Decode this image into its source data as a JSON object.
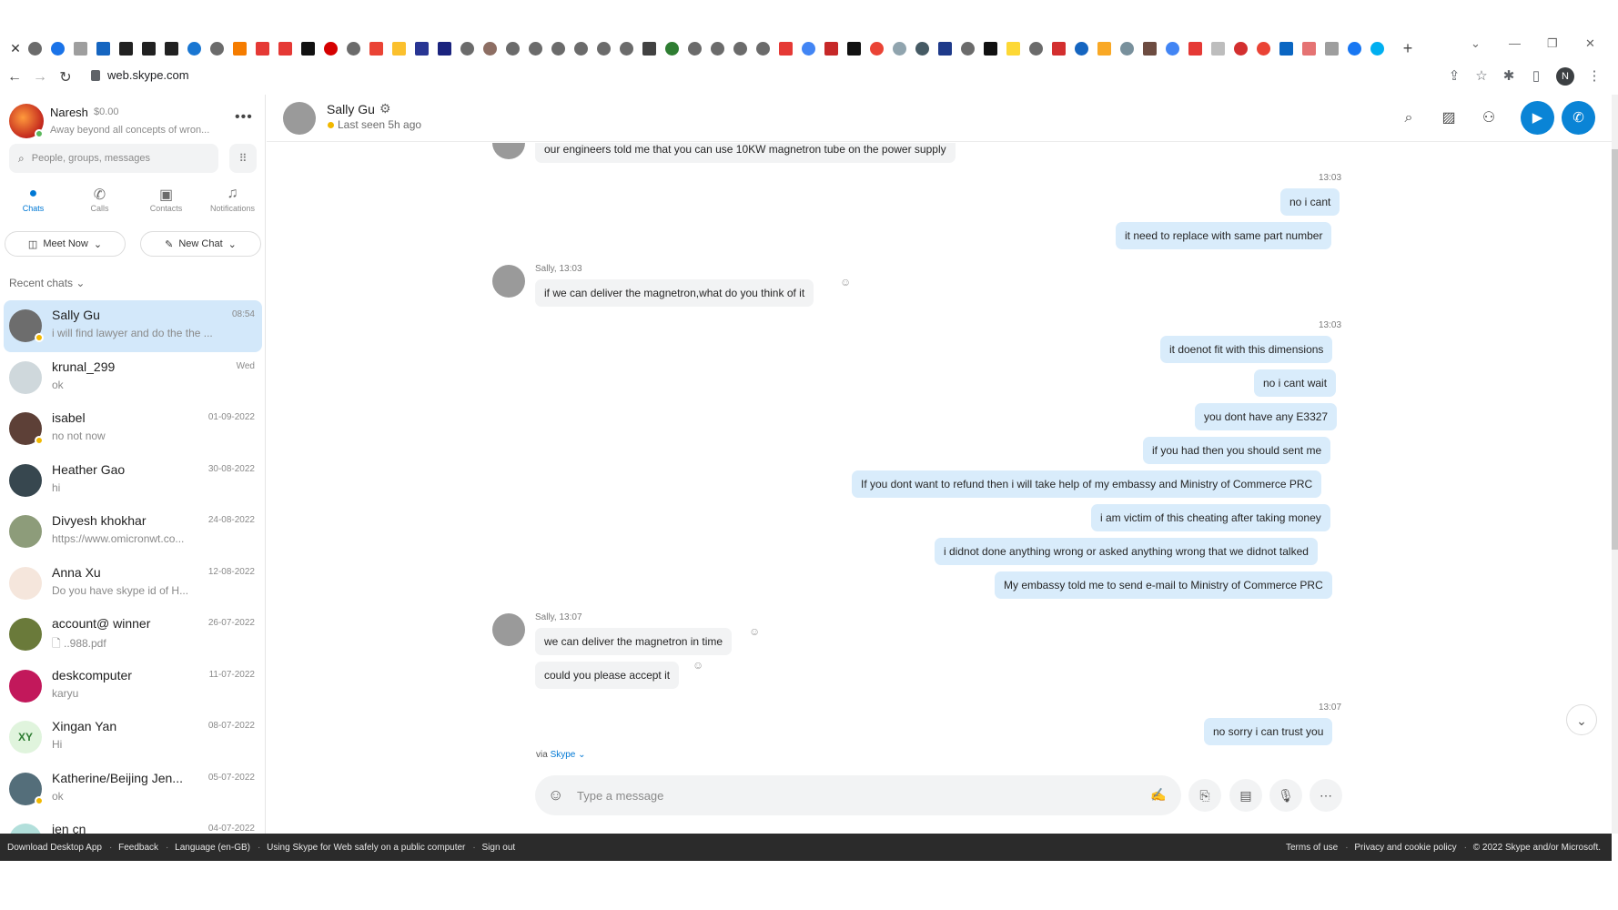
{
  "browser": {
    "url": "web.skype.com",
    "profile_initial": "N",
    "new_tab_label": "+"
  },
  "me": {
    "name": "Naresh",
    "credit": "$0.00",
    "mood": "Away beyond all concepts of wron..."
  },
  "search": {
    "placeholder": "People, groups, messages"
  },
  "nav": {
    "chats": "Chats",
    "calls": "Calls",
    "contacts": "Contacts",
    "notifications": "Notifications"
  },
  "actions": {
    "meet_now": "Meet Now",
    "new_chat": "New Chat"
  },
  "recent_label": "Recent chats",
  "chats": [
    {
      "name": "Sally Gu",
      "preview": "i will find lawyer and do the the ...",
      "date": "08:54",
      "selected": true
    },
    {
      "name": "krunal_299",
      "preview": "ok",
      "date": "Wed"
    },
    {
      "name": "isabel",
      "preview": "no not now",
      "date": "01-09-2022"
    },
    {
      "name": "Heather Gao",
      "preview": "hi",
      "date": "30-08-2022"
    },
    {
      "name": "Divyesh khokhar",
      "preview": "https://www.omicronwt.co...",
      "date": "24-08-2022"
    },
    {
      "name": "Anna Xu",
      "preview": "Do you have skype id of H...",
      "date": "12-08-2022"
    },
    {
      "name": "account@ winner",
      "preview": "..988.pdf",
      "date": "26-07-2022"
    },
    {
      "name": "deskcomputer",
      "preview": "karyu",
      "date": "11-07-2022"
    },
    {
      "name": "Xingan  Yan",
      "preview": "Hi",
      "date": "08-07-2022",
      "initials": "XY"
    },
    {
      "name": "Katherine/Beijing Jen...",
      "preview": "ok",
      "date": "05-07-2022"
    },
    {
      "name": "jen cn",
      "preview": "",
      "date": "04-07-2022"
    }
  ],
  "conversation": {
    "name": "Sally Gu",
    "status": "Last seen 5h ago",
    "messages": {
      "m0": "our engineers told me that you can use 10KW magnetron tube on the power supply",
      "t1": "13:03",
      "m1": "no i cant",
      "m2": "it need to replace with same part number",
      "s1": "Sally, 13:03",
      "m3": "if we can deliver the magnetron,what do you think of it",
      "t2": "13:03",
      "m4": "it doenot fit with this dimensions",
      "m5": "no i cant wait",
      "m6": "you dont have any E3327",
      "m7": "if you had then you should sent me",
      "m8": "If you dont want to refund then i will take help of my embassy and Ministry of Commerce PRC",
      "m9": "i am victim of this cheating after taking money",
      "m10": "i didnot done anything wrong or asked anything wrong that we didnot talked",
      "m11": "My embassy told me to send e-mail to Ministry of Commerce PRC",
      "s2": "Sally, 13:07",
      "m12": "we can deliver the magnetron in time",
      "m13": "could you please accept it",
      "t3": "13:07",
      "m14": "no sorry i can trust you"
    },
    "via_prefix": "via",
    "via_link": "Skype"
  },
  "composer": {
    "placeholder": "Type a message"
  },
  "footer": {
    "left": [
      "Download Desktop App",
      "Feedback",
      "Language (en-GB)",
      "Using Skype for Web safely on a public computer",
      "Sign out"
    ],
    "right": [
      "Terms of use",
      "Privacy and cookie policy",
      "© 2022 Skype and/or Microsoft."
    ]
  }
}
